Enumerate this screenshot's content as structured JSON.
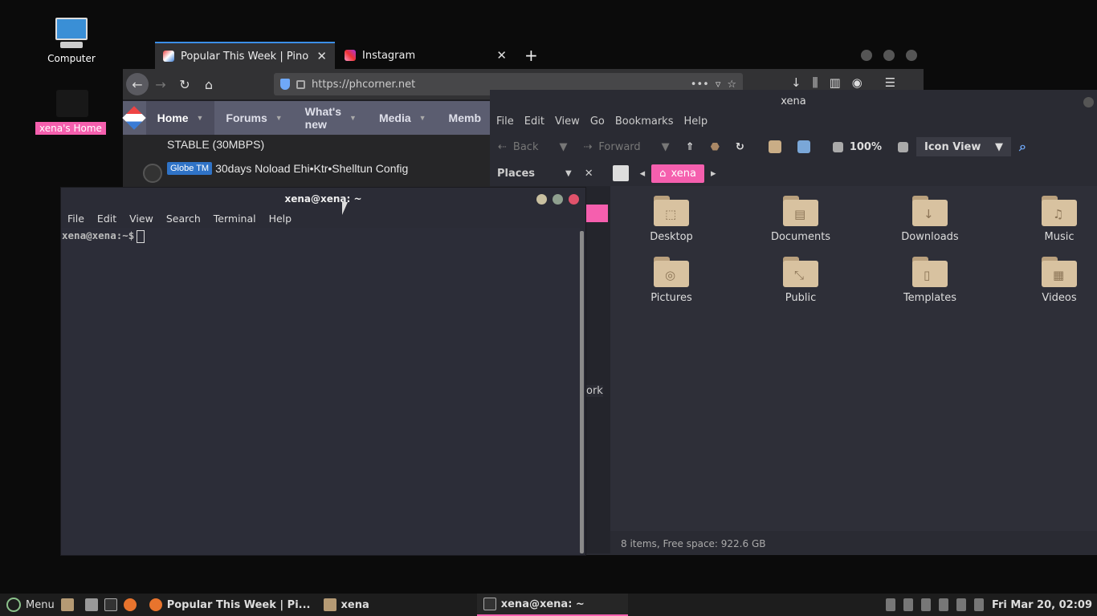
{
  "desktop": {
    "computer_label": "Computer",
    "home_label": "xena's Home"
  },
  "browser": {
    "tabs": [
      {
        "label": "Popular This Week | Pinoy I",
        "active": true
      },
      {
        "label": "Instagram",
        "active": false
      }
    ],
    "new_tab": "+",
    "url": "https://phcorner.net",
    "url_more": "•••",
    "site_nav": [
      "Home",
      "Forums",
      "What's new",
      "Media",
      "Memb"
    ],
    "content": {
      "line1": "STABLE (30MBPS)",
      "badge": "Globe TM",
      "line2": "30days Noload Ehi•Ktr•Shelltun Config"
    }
  },
  "terminal": {
    "title": "xena@xena: ~",
    "menu": [
      "File",
      "Edit",
      "View",
      "Search",
      "Terminal",
      "Help"
    ],
    "prompt": "xena@xena:~$",
    "bg_fragment": "ork"
  },
  "file_manager": {
    "title": "xena",
    "menu": [
      "File",
      "Edit",
      "View",
      "Go",
      "Bookmarks",
      "Help"
    ],
    "back": "Back",
    "forward": "Forward",
    "zoom": "100%",
    "view_mode": "Icon View",
    "places": "Places",
    "crumb": "xena",
    "folders": [
      {
        "name": "Desktop",
        "glyph": "⬚"
      },
      {
        "name": "Documents",
        "glyph": "▤"
      },
      {
        "name": "Downloads",
        "glyph": "↓"
      },
      {
        "name": "Music",
        "glyph": "♫"
      },
      {
        "name": "Pictures",
        "glyph": "◎"
      },
      {
        "name": "Public",
        "glyph": "⤡"
      },
      {
        "name": "Templates",
        "glyph": "▯"
      },
      {
        "name": "Videos",
        "glyph": "▦"
      }
    ],
    "status": "8 items, Free space: 922.6 GB"
  },
  "taskbar": {
    "menu": "Menu",
    "tasks": [
      {
        "label": "Popular This Week | Pi...",
        "active": false
      },
      {
        "label": "xena",
        "active": false
      },
      {
        "label": "xena@xena: ~",
        "active": true
      }
    ],
    "clock": "Fri Mar 20, 02:09"
  },
  "colors": {
    "accent": "#f55fae",
    "tab_highlight": "#3b8fe8"
  }
}
